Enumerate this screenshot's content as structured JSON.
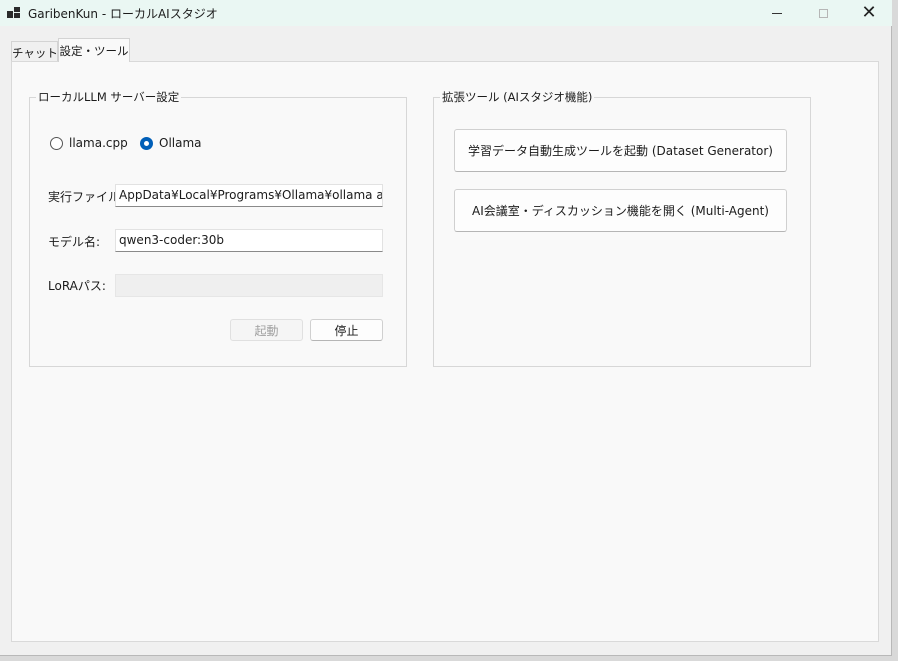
{
  "window": {
    "title": "GaribenKun - ローカルAIスタジオ"
  },
  "tabs": [
    {
      "label": "チャット"
    },
    {
      "label": "設定・ツール"
    }
  ],
  "llm_group": {
    "title": "ローカルLLM サーバー設定",
    "radios": [
      {
        "label": "llama.cpp",
        "checked": false
      },
      {
        "label": "Ollama",
        "checked": true
      }
    ],
    "exe_label": "実行ファイル:",
    "exe_value": "AppData¥Local¥Programs¥Ollama¥ollama app.exe",
    "model_label": "モデル名:",
    "model_value": "qwen3-coder:30b",
    "lora_label": "LoRAパス:",
    "lora_value": "",
    "start_label": "起動",
    "stop_label": "停止"
  },
  "tools_group": {
    "title": "拡張ツール (AIスタジオ機能)",
    "dataset_button": "学習データ自動生成ツールを起動 (Dataset Generator)",
    "agent_button": "AI会議室・ディスカッション機能を開く (Multi-Agent)"
  },
  "colors": {
    "accent": "#005fb8",
    "titlebar": "#eaf7f3",
    "tabpage": "#f9f9f9"
  }
}
